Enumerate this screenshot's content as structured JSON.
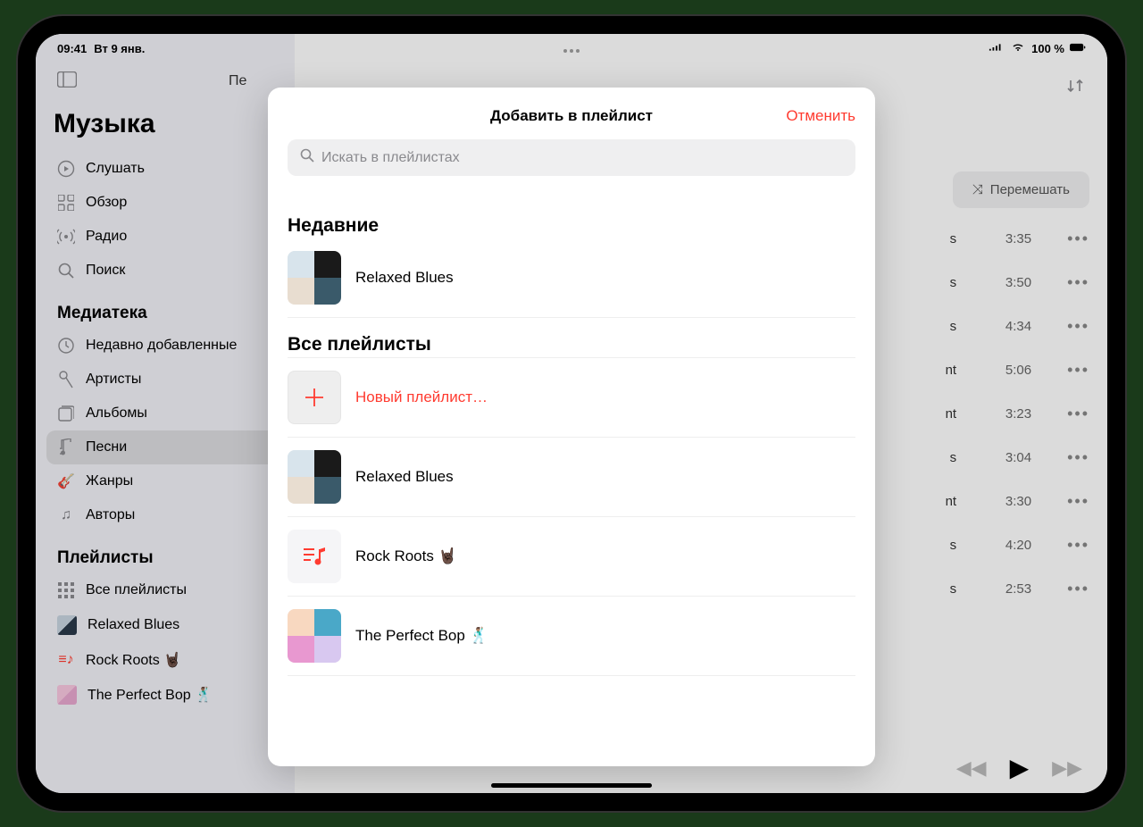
{
  "status": {
    "time": "09:41",
    "date": "Вт 9 янв.",
    "battery": "100 %"
  },
  "app": {
    "title": "Музыка",
    "nav": {
      "listen": "Слушать",
      "browse": "Обзор",
      "radio": "Радио",
      "search": "Поиск"
    },
    "library": {
      "heading": "Медиатека",
      "recent": "Недавно добавленные",
      "artists": "Артисты",
      "albums": "Альбомы",
      "songs": "Песни",
      "genres": "Жанры",
      "composers": "Авторы"
    },
    "playlists_section": {
      "heading": "Плейлисты",
      "all": "Все плейлисты",
      "items": [
        "Relaxed Blues",
        "Rock Roots 🤘🏿",
        "The Perfect Bop 🕺🏽"
      ]
    }
  },
  "main": {
    "truncated_header": "Пе",
    "shuffle": "Перемешать",
    "songs": [
      {
        "artist_suffix": "s",
        "time": "3:35"
      },
      {
        "artist_suffix": "s",
        "time": "3:50"
      },
      {
        "artist_suffix": "s",
        "time": "4:34"
      },
      {
        "artist_suffix": "nt",
        "time": "5:06"
      },
      {
        "artist_suffix": "nt",
        "time": "3:23"
      },
      {
        "artist_suffix": "s",
        "time": "3:04"
      },
      {
        "artist_suffix": "nt",
        "time": "3:30"
      },
      {
        "artist_suffix": "s",
        "time": "4:20"
      },
      {
        "artist_suffix": "s",
        "time": "2:53"
      }
    ]
  },
  "modal": {
    "title": "Добавить в плейлист",
    "cancel": "Отменить",
    "search_placeholder": "Искать в плейлистах",
    "recent_heading": "Недавние",
    "recent_items": [
      {
        "name": "Relaxed Blues"
      }
    ],
    "all_heading": "Все плейлисты",
    "new_playlist": "Новый плейлист…",
    "all_items": [
      {
        "name": "Relaxed Blues"
      },
      {
        "name": "Rock Roots 🤘🏿"
      },
      {
        "name": "The Perfect Bop 🕺🏽"
      }
    ]
  }
}
